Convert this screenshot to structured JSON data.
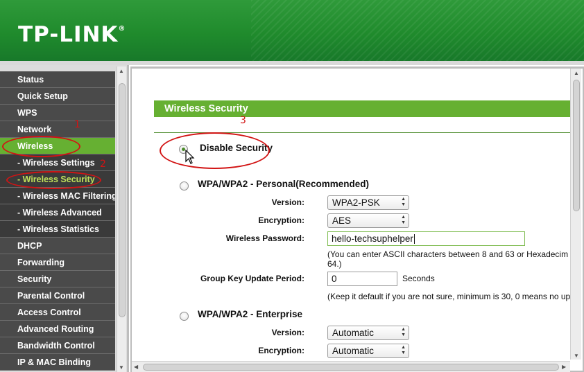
{
  "brand": {
    "logo_text": "TP-LINK",
    "registered_mark": "®"
  },
  "menu": {
    "items": [
      {
        "label": "Status",
        "type": "main"
      },
      {
        "label": "Quick Setup",
        "type": "main"
      },
      {
        "label": "WPS",
        "type": "main"
      },
      {
        "label": "Network",
        "type": "main"
      },
      {
        "label": "Wireless",
        "type": "main",
        "active": true
      },
      {
        "label": "- Wireless Settings",
        "type": "sub"
      },
      {
        "label": "- Wireless Security",
        "type": "sub",
        "active": true
      },
      {
        "label": "- Wireless MAC Filtering",
        "type": "sub"
      },
      {
        "label": "- Wireless Advanced",
        "type": "sub"
      },
      {
        "label": "- Wireless Statistics",
        "type": "sub"
      },
      {
        "label": "DHCP",
        "type": "main"
      },
      {
        "label": "Forwarding",
        "type": "main"
      },
      {
        "label": "Security",
        "type": "main"
      },
      {
        "label": "Parental Control",
        "type": "main"
      },
      {
        "label": "Access Control",
        "type": "main"
      },
      {
        "label": "Advanced Routing",
        "type": "main"
      },
      {
        "label": "Bandwidth Control",
        "type": "main"
      },
      {
        "label": "IP & MAC Binding",
        "type": "main"
      }
    ]
  },
  "page": {
    "title": "Wireless Security",
    "disable_security": {
      "label": "Disable Security",
      "selected": true
    },
    "personal": {
      "label": "WPA/WPA2 - Personal(Recommended)",
      "version_label": "Version:",
      "version_value": "WPA2-PSK",
      "encryption_label": "Encryption:",
      "encryption_value": "AES",
      "password_label": "Wireless Password:",
      "password_value": "hello-techsuphelper",
      "password_hint_line1": "(You can enter ASCII characters between 8 and 63 or Hexadecim",
      "password_hint_line2": "64.)",
      "group_key_label": "Group Key Update Period:",
      "group_key_value": "0",
      "group_key_unit": "Seconds",
      "group_key_hint": "(Keep it default if you are not sure, minimum is 30, 0 means no up"
    },
    "enterprise": {
      "label": "WPA/WPA2 - Enterprise",
      "version_label": "Version:",
      "version_value": "Automatic",
      "encryption_label": "Encryption:",
      "encryption_value": "Automatic"
    }
  },
  "annotations": {
    "step1": "1",
    "step2": "2",
    "step3": "3",
    "color": "#d21414"
  },
  "colors": {
    "brand_green": "#1f8a2c",
    "menu_active": "#66b032",
    "menu_bg": "#4a4a4a"
  }
}
